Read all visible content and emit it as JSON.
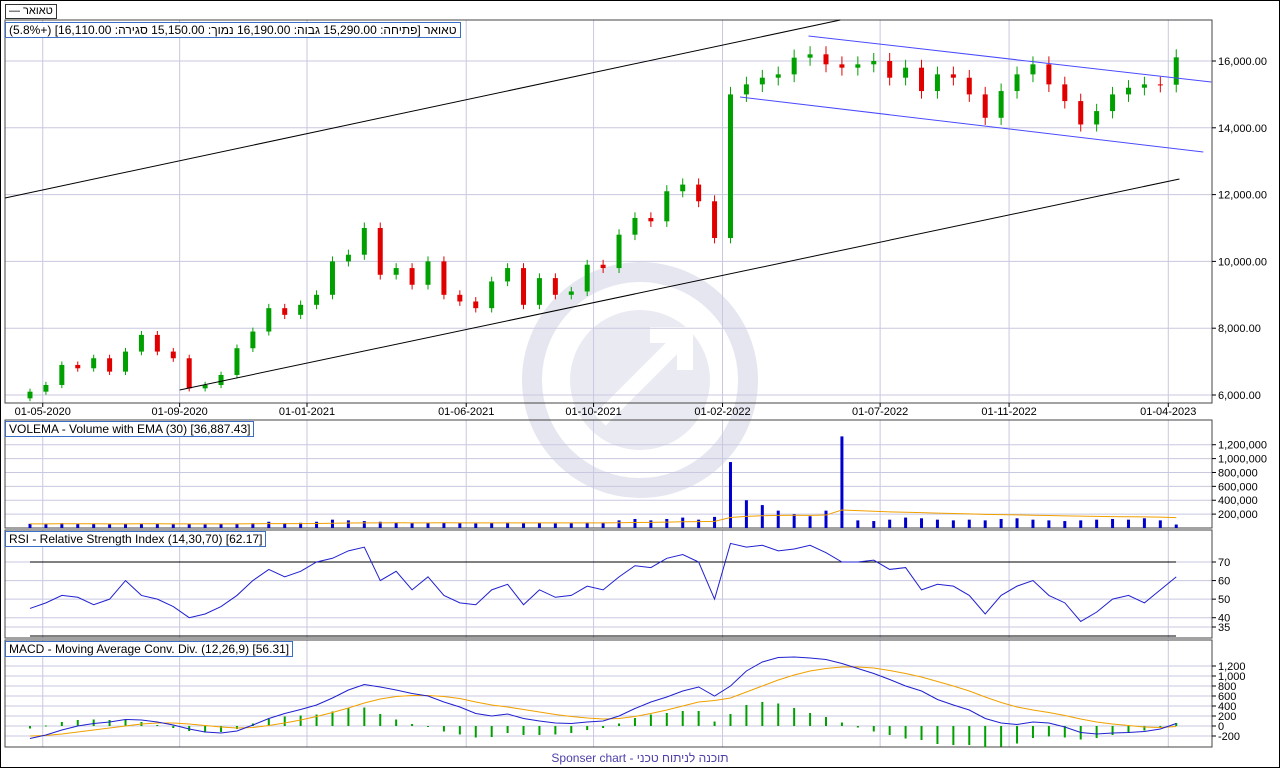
{
  "header": {
    "legend_label": "טאואר —",
    "price_info": "טאואר [פתיחה: 15,290.00  גבוה: 16,190.00  נמוך: 15,150.00  סגירה: 16,110.00] (+5.8%)"
  },
  "footer": {
    "sponsor": "Sponser chart - תוכנה לניתוח טכני"
  },
  "colors": {
    "up": "#00a000",
    "down": "#e00000",
    "volume": "#0000cc",
    "ema": "#f0a000",
    "rsi": "#2020d0",
    "macd": "#2020d0",
    "signal": "#f0a000",
    "hist": "#00a000",
    "trend_black": "#000000",
    "trend_blue": "#4a4aff",
    "grid": "#c8c8e0"
  },
  "chart_data": [
    {
      "type": "candlestick",
      "title": "טאואר",
      "x_ticks": [
        {
          "label": "01-05-2020",
          "index": 0.8
        },
        {
          "label": "01-09-2020",
          "index": 9.4
        },
        {
          "label": "01-01-2021",
          "index": 17.4
        },
        {
          "label": "01-06-2021",
          "index": 27.4
        },
        {
          "label": "01-10-2021",
          "index": 35.4
        },
        {
          "label": "01-02-2022",
          "index": 43.5
        },
        {
          "label": "01-07-2022",
          "index": 53.4
        },
        {
          "label": "01-11-2022",
          "index": 61.5
        },
        {
          "label": "01-04-2023",
          "index": 71.5
        }
      ],
      "y_ticks": [
        "6,000.00",
        "8,000.00",
        "10,000.00",
        "12,000.00",
        "14,000.00",
        "16,000.00"
      ],
      "y_tick_values": [
        6000,
        8000,
        10000,
        12000,
        14000,
        16000
      ],
      "ylim": [
        5800,
        17500
      ],
      "close": [
        6100,
        6300,
        6900,
        6800,
        7100,
        6700,
        7300,
        7800,
        7300,
        7100,
        6200,
        6300,
        6600,
        7400,
        7900,
        8600,
        8400,
        8700,
        9000,
        10000,
        10200,
        11000,
        9600,
        9800,
        9300,
        10000,
        9000,
        8800,
        8600,
        9400,
        9800,
        8700,
        9500,
        9000,
        9100,
        9900,
        9800,
        10800,
        11300,
        11200,
        12100,
        12300,
        11800,
        10700,
        15000,
        15300,
        15500,
        15600,
        16100,
        16200,
        15900,
        15800,
        15900,
        16000,
        15500,
        15800,
        15100,
        15600,
        15500,
        15000,
        14300,
        15100,
        15600,
        15900,
        15300,
        14800,
        14100,
        14500,
        15000,
        15200,
        15300,
        15290,
        16110
      ],
      "first_open": 5900,
      "trendlines": [
        {
          "color": "black",
          "from": [
            -1.9,
            11898
          ],
          "to": [
            50.9,
            17228
          ]
        },
        {
          "color": "black",
          "from": [
            9.4,
            6150
          ],
          "to": [
            72.2,
            12467
          ]
        },
        {
          "color": "blue",
          "from": [
            48.9,
            16749
          ],
          "to": [
            74.2,
            15371
          ]
        },
        {
          "color": "blue",
          "from": [
            44.6,
            14922
          ],
          "to": [
            73.7,
            13275
          ]
        }
      ]
    },
    {
      "type": "bar",
      "title": "VOLEMA - Volume with EMA (30) [36,887.43]",
      "y_ticks": [
        "200,000",
        "400,000",
        "600,000",
        "800,000",
        "1,000,000",
        "1,200,000"
      ],
      "y_tick_values": [
        200000,
        400000,
        600000,
        800000,
        1000000,
        1200000
      ],
      "ema_period": 30,
      "values": [
        60000,
        55000,
        70000,
        65000,
        60000,
        55000,
        60000,
        65000,
        60000,
        55000,
        60000,
        50000,
        65000,
        60000,
        70000,
        90000,
        70000,
        75000,
        90000,
        120000,
        110000,
        100000,
        90000,
        80000,
        70000,
        75000,
        80000,
        70000,
        65000,
        75000,
        80000,
        70000,
        75000,
        65000,
        70000,
        80000,
        80000,
        110000,
        130000,
        110000,
        130000,
        150000,
        120000,
        160000,
        950000,
        400000,
        330000,
        250000,
        200000,
        170000,
        250000,
        1320000,
        110000,
        100000,
        120000,
        150000,
        140000,
        120000,
        110000,
        120000,
        110000,
        130000,
        140000,
        120000,
        110000,
        100000,
        110000,
        120000,
        130000,
        120000,
        140000,
        110000,
        50000
      ]
    },
    {
      "type": "line",
      "title": "RSI - Relative Strength Index (14,30,70) [62.17]",
      "y_ticks": [
        "35",
        "40",
        "50",
        "60",
        "70"
      ],
      "y_tick_values": [
        35,
        40,
        50,
        60,
        70
      ],
      "levels": [
        70,
        30
      ],
      "values": [
        45,
        48,
        52,
        51,
        47,
        50,
        60,
        52,
        50,
        46,
        40,
        42,
        46,
        52,
        60,
        66,
        62,
        65,
        70,
        72,
        76,
        78,
        60,
        65,
        55,
        62,
        52,
        48,
        47,
        55,
        58,
        47,
        55,
        51,
        52,
        57,
        55,
        62,
        68,
        67,
        72,
        74,
        70,
        50,
        80,
        78,
        79,
        76,
        77,
        79,
        75,
        70,
        70,
        71,
        66,
        67,
        55,
        58,
        57,
        52,
        42,
        52,
        57,
        60,
        52,
        48,
        38,
        43,
        50,
        52,
        48,
        55,
        62
      ]
    },
    {
      "type": "line",
      "title": "MACD - Moving Average Conv. Div. (12,26,9) [56.31]",
      "y_ticks": [
        "-200",
        "0",
        "200",
        "400",
        "600",
        "800",
        "1,000",
        "1,200"
      ],
      "y_tick_values": [
        -200,
        0,
        200,
        400,
        600,
        800,
        1000,
        1200
      ],
      "macd": [
        -250,
        -180,
        -80,
        0,
        50,
        80,
        130,
        120,
        80,
        20,
        -60,
        -120,
        -140,
        -100,
        20,
        150,
        250,
        330,
        420,
        560,
        720,
        830,
        780,
        720,
        650,
        600,
        480,
        380,
        250,
        200,
        240,
        150,
        100,
        60,
        50,
        80,
        100,
        200,
        350,
        480,
        580,
        700,
        780,
        600,
        800,
        1100,
        1280,
        1370,
        1380,
        1360,
        1330,
        1250,
        1150,
        1050,
        930,
        800,
        700,
        530,
        420,
        320,
        150,
        60,
        30,
        80,
        60,
        -20,
        -130,
        -160,
        -140,
        -130,
        -110,
        -60,
        50
      ],
      "signal": [
        -200,
        -190,
        -160,
        -120,
        -80,
        -40,
        0,
        40,
        60,
        60,
        40,
        10,
        -20,
        -40,
        -30,
        10,
        60,
        120,
        190,
        270,
        360,
        460,
        540,
        590,
        610,
        610,
        590,
        550,
        480,
        420,
        380,
        330,
        280,
        230,
        190,
        160,
        140,
        150,
        190,
        250,
        320,
        400,
        480,
        510,
        560,
        680,
        800,
        920,
        1020,
        1100,
        1150,
        1180,
        1180,
        1160,
        1110,
        1050,
        980,
        890,
        800,
        700,
        580,
        470,
        380,
        320,
        270,
        210,
        140,
        80,
        40,
        10,
        -20,
        -30,
        -10
      ]
    }
  ]
}
